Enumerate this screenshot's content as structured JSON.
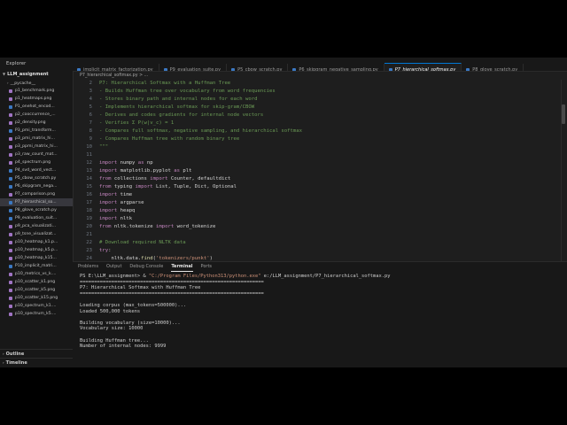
{
  "sidebar": {
    "title": "Explorer",
    "root": "LLM_assignment",
    "items": [
      {
        "label": "__pycache__",
        "type": "folder"
      },
      {
        "label": "p1_benchmark.png",
        "type": "png"
      },
      {
        "label": "p1_heatmaps.png",
        "type": "png"
      },
      {
        "label": "P1_onehot_encod...",
        "type": "py"
      },
      {
        "label": "p2_cooccurrence_...",
        "type": "png"
      },
      {
        "label": "p2_density.png",
        "type": "png"
      },
      {
        "label": "P3_pmi_transform...",
        "type": "py"
      },
      {
        "label": "p3_pmi_matrix_hi...",
        "type": "png"
      },
      {
        "label": "p3_ppmi_matrix_hi...",
        "type": "png"
      },
      {
        "label": "p3_raw_count_mat...",
        "type": "png"
      },
      {
        "label": "p4_spectrum.png",
        "type": "png"
      },
      {
        "label": "P4_svd_word_vect...",
        "type": "py"
      },
      {
        "label": "P5_cbow_scratch.py",
        "type": "py"
      },
      {
        "label": "P6_skipgram_nega...",
        "type": "py"
      },
      {
        "label": "P7_comparison.png",
        "type": "png"
      },
      {
        "label": "P7_hierarchical_so...",
        "type": "py",
        "active": true
      },
      {
        "label": "P8_glove_scratch.py",
        "type": "py"
      },
      {
        "label": "P9_evaluation_suit...",
        "type": "py"
      },
      {
        "label": "p9_pca_visualizati...",
        "type": "png"
      },
      {
        "label": "p9_tsne_visualizat...",
        "type": "png"
      },
      {
        "label": "p10_heatmap_k1.p...",
        "type": "png"
      },
      {
        "label": "p10_heatmap_k5.p...",
        "type": "png"
      },
      {
        "label": "p10_heatmap_k15...",
        "type": "png"
      },
      {
        "label": "P10_implicit_matri...",
        "type": "py"
      },
      {
        "label": "p10_metrics_vs_k....",
        "type": "png"
      },
      {
        "label": "p10_scatter_k1.png",
        "type": "png"
      },
      {
        "label": "p10_scatter_k5.png",
        "type": "png"
      },
      {
        "label": "p10_scatter_k15.png",
        "type": "png"
      },
      {
        "label": "p10_spectrum_k1....",
        "type": "png"
      },
      {
        "label": "p10_spectrum_k5....",
        "type": "png"
      }
    ],
    "outline": "Outline",
    "timeline": "Timeline"
  },
  "tabs": [
    {
      "label": "implicit_matrix_factorization.py",
      "active": false
    },
    {
      "label": "P9_evaluation_suite.py",
      "active": false
    },
    {
      "label": "P5_cbow_scratch.py",
      "active": false
    },
    {
      "label": "P6_skipgram_negative_sampling.py",
      "active": false
    },
    {
      "label": "P7_hierarchical_softmax.py",
      "active": true
    },
    {
      "label": "P8_glove_scratch.py",
      "active": false
    }
  ],
  "breadcrumb": "P7_hierarchical_softmax.py > ...",
  "editor": {
    "lines": [
      {
        "n": "2",
        "parts": [
          {
            "c": "cm",
            "t": "P7: Hierarchical Softmax with a Huffman Tree"
          }
        ]
      },
      {
        "n": "3",
        "parts": [
          {
            "c": "cm",
            "t": "- Builds Huffman tree over vocabulary from word frequencies"
          }
        ]
      },
      {
        "n": "4",
        "parts": [
          {
            "c": "cm",
            "t": "- Stores binary path and internal nodes for each word"
          }
        ]
      },
      {
        "n": "5",
        "parts": [
          {
            "c": "cm",
            "t": "- Implements hierarchical softmax for skip-gram/CBOW"
          }
        ]
      },
      {
        "n": "6",
        "parts": [
          {
            "c": "cm",
            "t": "- Derives and codes gradients for internal node vectors"
          }
        ]
      },
      {
        "n": "7",
        "parts": [
          {
            "c": "cm",
            "t": "- Verifies Σ P(w|v_c) = 1"
          }
        ]
      },
      {
        "n": "8",
        "parts": [
          {
            "c": "cm",
            "t": "- Compares full softmax, negative sampling, and hierarchical softmax"
          }
        ]
      },
      {
        "n": "9",
        "parts": [
          {
            "c": "cm",
            "t": "- Compares Huffman tree with random binary tree"
          }
        ]
      },
      {
        "n": "10",
        "parts": [
          {
            "c": "cm",
            "t": "\"\"\""
          }
        ]
      },
      {
        "n": "11",
        "parts": []
      },
      {
        "n": "12",
        "parts": [
          {
            "c": "kw",
            "t": "import"
          },
          {
            "c": "df",
            "t": " numpy "
          },
          {
            "c": "kw",
            "t": "as"
          },
          {
            "c": "df",
            "t": " np"
          }
        ]
      },
      {
        "n": "13",
        "parts": [
          {
            "c": "kw",
            "t": "import"
          },
          {
            "c": "df",
            "t": " matplotlib.pyplot "
          },
          {
            "c": "kw",
            "t": "as"
          },
          {
            "c": "df",
            "t": " plt"
          }
        ]
      },
      {
        "n": "14",
        "parts": [
          {
            "c": "kw",
            "t": "from"
          },
          {
            "c": "df",
            "t": " collections "
          },
          {
            "c": "kw",
            "t": "import"
          },
          {
            "c": "df",
            "t": " Counter, defaultdict"
          }
        ]
      },
      {
        "n": "15",
        "parts": [
          {
            "c": "kw",
            "t": "from"
          },
          {
            "c": "df",
            "t": " typing "
          },
          {
            "c": "kw",
            "t": "import"
          },
          {
            "c": "df",
            "t": " List, Tuple, Dict, Optional"
          }
        ]
      },
      {
        "n": "16",
        "parts": [
          {
            "c": "kw",
            "t": "import"
          },
          {
            "c": "df",
            "t": " time"
          }
        ]
      },
      {
        "n": "17",
        "parts": [
          {
            "c": "kw",
            "t": "import"
          },
          {
            "c": "df",
            "t": " argparse"
          }
        ]
      },
      {
        "n": "18",
        "parts": [
          {
            "c": "kw",
            "t": "import"
          },
          {
            "c": "df",
            "t": " heapq"
          }
        ]
      },
      {
        "n": "19",
        "parts": [
          {
            "c": "kw",
            "t": "import"
          },
          {
            "c": "df",
            "t": " nltk"
          }
        ]
      },
      {
        "n": "20",
        "parts": [
          {
            "c": "kw",
            "t": "from"
          },
          {
            "c": "df",
            "t": " nltk.tokenize "
          },
          {
            "c": "kw",
            "t": "import"
          },
          {
            "c": "df",
            "t": " word_tokenize"
          }
        ]
      },
      {
        "n": "21",
        "parts": []
      },
      {
        "n": "22",
        "parts": [
          {
            "c": "cm",
            "t": "# Download required NLTK data"
          }
        ]
      },
      {
        "n": "23",
        "parts": [
          {
            "c": "kw",
            "t": "try"
          },
          {
            "c": "df",
            "t": ":"
          }
        ]
      },
      {
        "n": "24",
        "parts": [
          {
            "c": "df",
            "t": "    nltk.data."
          },
          {
            "c": "fn",
            "t": "find"
          },
          {
            "c": "df",
            "t": "("
          },
          {
            "c": "st",
            "t": "'tokenizers/punkt'"
          },
          {
            "c": "df",
            "t": ")"
          }
        ]
      }
    ]
  },
  "panel": {
    "tabs": [
      {
        "label": "Problems",
        "active": false
      },
      {
        "label": "Output",
        "active": false
      },
      {
        "label": "Debug Console",
        "active": false
      },
      {
        "label": "Terminal",
        "active": true
      },
      {
        "label": "Ports",
        "active": false
      }
    ],
    "prompt": "PS E:\\LLM_assignment> & ",
    "exe": "\"C:/Program Files/Python313/python.exe\"",
    "script": " e:/LLM_assignment/P7_hierarchical_softmax.py",
    "output": [
      "================================================================",
      "P7: Hierarchical Softmax with Huffman Tree",
      "================================================================",
      "",
      "Loading corpus (max_tokens=500000)...",
      "Loaded 500,000 tokens",
      "",
      "Building vocabulary (size=10000)...",
      "Vocabulary size: 10000",
      "",
      "Building Huffman tree...",
      "Number of internal nodes: 9999"
    ]
  }
}
